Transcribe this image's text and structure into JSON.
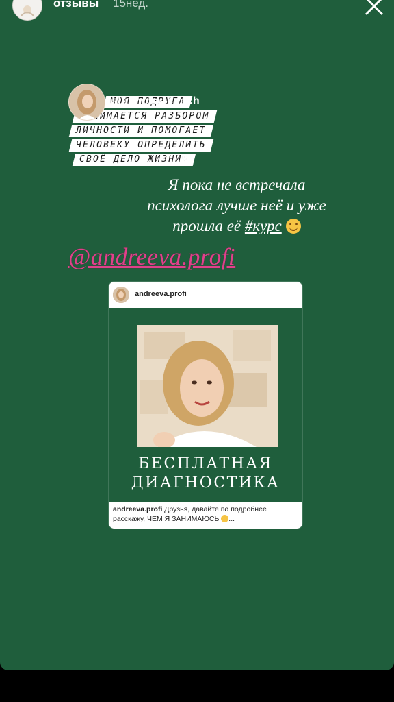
{
  "header": {
    "username": "отзывы",
    "time": "15нед."
  },
  "mention_sticker": {
    "handle": "astakhova_coach",
    "lines": [
      "моя подруга",
      "занимается разбором",
      "личности и помогает",
      "человеку определить",
      "своё дело жизни"
    ]
  },
  "story_text": {
    "line1": "Я пока не встречала",
    "line2": "психолога лучше неё и уже",
    "line3_prefix": "прошла её ",
    "hashtag": "#курс"
  },
  "mention_big": "@andreeva.profi",
  "post": {
    "username": "andreeva.profi",
    "headline_1": "БЕСПЛАТНАЯ",
    "headline_2": "ДИАГНОСТИКА",
    "caption_user": "andreeva.profi",
    "caption_text": "Друзья, давайте по подробнее расскажу, ЧЕМ Я ЗАНИМАЮСЬ",
    "caption_ellipsis": "..."
  },
  "colors": {
    "background": "#1f5e3c",
    "mention": "#e0418b"
  }
}
